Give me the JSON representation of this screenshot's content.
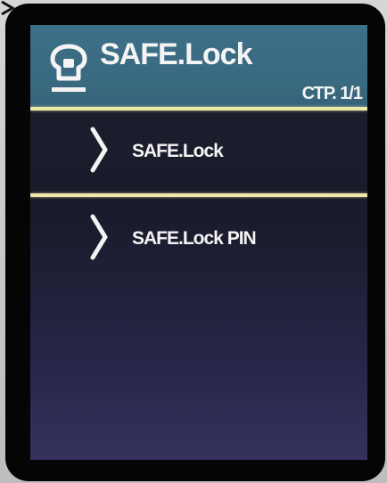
{
  "header": {
    "title": "SAFE.Lock",
    "page_indicator": "СТР. 1/1",
    "icon": "safe-lock-icon"
  },
  "menu": {
    "items": [
      {
        "label": "SAFE.Lock",
        "icon": "chevron-right-icon"
      },
      {
        "label": "SAFE.Lock PIN",
        "icon": "chevron-right-icon"
      }
    ]
  },
  "colors": {
    "header_bg": "#3a6a80",
    "divider": "#f0e8a8",
    "screen_bg": "#1c1f2c",
    "text": "#f4f4f4"
  }
}
